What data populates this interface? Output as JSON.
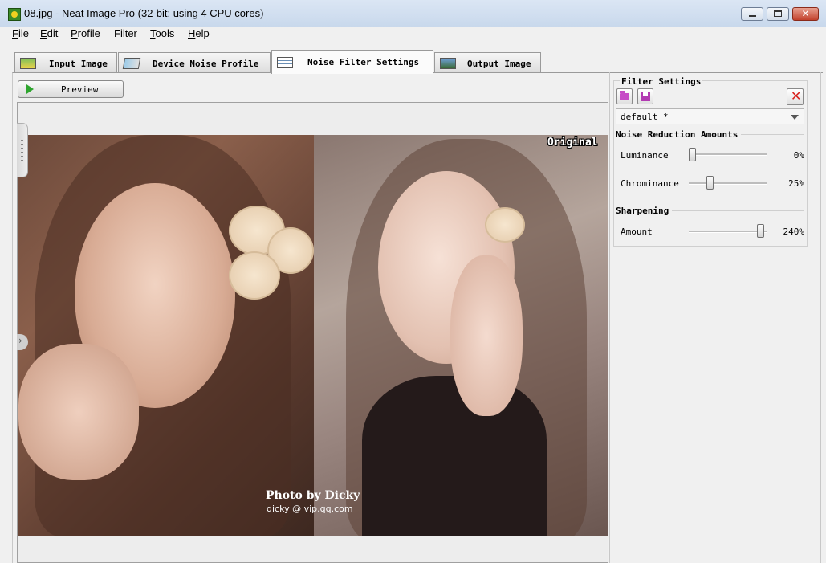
{
  "window": {
    "title": "08.jpg - Neat Image Pro (32-bit; using 4 CPU cores)",
    "buttons": {
      "close": "✕"
    }
  },
  "menu": [
    {
      "accel": "F",
      "rest": "ile"
    },
    {
      "accel": "E",
      "rest": "dit"
    },
    {
      "accel": "P",
      "rest": "rofile"
    },
    {
      "accel": "F",
      "rest": "ilter",
      "underline_index": 3
    },
    {
      "accel": "T",
      "rest": "ools"
    },
    {
      "accel": "H",
      "rest": "elp"
    }
  ],
  "menu_text": [
    "File",
    "Edit",
    "Profile",
    "Filter",
    "Tools",
    "Help"
  ],
  "tabs": [
    {
      "label": "Input Image",
      "icon": "input-image-icon",
      "active": false
    },
    {
      "label": "Device Noise Profile",
      "icon": "device-profile-icon",
      "active": false
    },
    {
      "label": "Noise Filter Settings",
      "icon": "filter-settings-icon",
      "active": true
    },
    {
      "label": "Output Image",
      "icon": "output-image-icon",
      "active": false
    }
  ],
  "preview": {
    "label": "Preview",
    "icon": "play-icon"
  },
  "image": {
    "overlay_label": "Original",
    "watermark_line1": "Photo by Dicky",
    "watermark_line2": "dicky @ vip.qq.com"
  },
  "filter_settings": {
    "title": "Filter Settings",
    "icons": [
      "open-folder-icon",
      "save-disk-icon",
      "delete-icon"
    ],
    "delete_glyph": "✕",
    "profile_selected": "default *",
    "noise_reduction_title": "Noise Reduction Amounts",
    "luminance": {
      "label": "Luminance",
      "value_text": "0%",
      "value": 0,
      "max": 100
    },
    "chrominance": {
      "label": "Chrominance",
      "value_text": "25%",
      "value": 25,
      "max": 100
    },
    "sharpening_title": "Sharpening",
    "amount": {
      "label": "Amount",
      "value_text": "240%",
      "value": 240,
      "max": 250
    }
  },
  "colors": {
    "accent_green": "#2ea52e",
    "delete_red": "#d8201c",
    "folder_magenta": "#c64bc6"
  }
}
